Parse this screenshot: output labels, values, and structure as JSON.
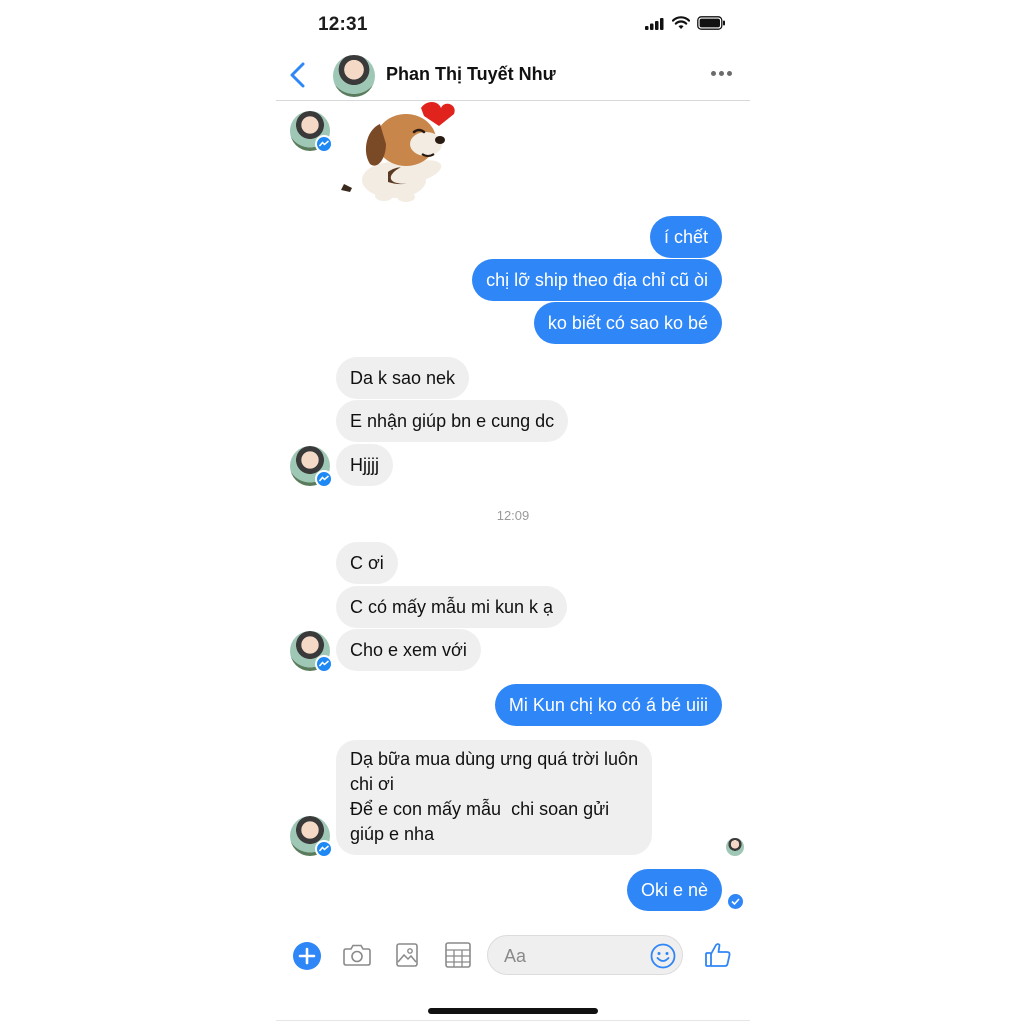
{
  "status": {
    "time": "12:31"
  },
  "header": {
    "contact_name": "Phan Thị Tuyết Như"
  },
  "messages": {
    "out1": "í chết",
    "out2": "chị lỡ ship theo địa chỉ cũ òi",
    "out3": "ko biết có sao ko bé",
    "in1": "Da k sao nek",
    "in2": "E nhận giúp bn e cung dc",
    "in3": "Hjjjj",
    "timestamp": "12:09",
    "in4": "C ơi",
    "in5": "C có mấy mẫu mi kun k ạ",
    "in6": "Cho e xem với",
    "out4": "Mi Kun chị ko có á bé uiii",
    "in7": "Dạ bữa mua dùng ưng quá trời luôn\nchi ơi\nĐể e con mấy mẫu  chi soan gửi\ngiúp e nha",
    "out5": "Oki e nè"
  },
  "composer": {
    "placeholder": "Aa"
  },
  "colors": {
    "accent": "#2f86f6",
    "incoming_bubble": "#efefef"
  },
  "icons": [
    "back-chevron-icon",
    "more-dots-icon",
    "messenger-badge-icon",
    "plus-icon",
    "camera-icon",
    "photo-icon",
    "sticker-grid-icon",
    "emoji-icon",
    "thumbs-up-icon"
  ]
}
